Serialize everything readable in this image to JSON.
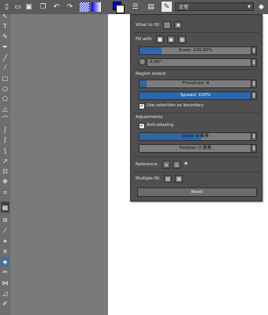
{
  "toolbar": {
    "blend_mode": "正常",
    "colors": {
      "primary": "#0000ff",
      "secondary": "#ffffff",
      "accent": "#2e66a8"
    }
  },
  "panel": {
    "what_to_fill": "What to fill",
    "fill_with": "Fill with",
    "scale_label": "Scale: 100.00%",
    "scale_fraction": 0.2,
    "angle_value": "0.00°",
    "region_extent": "Region extent",
    "threshold_label": "Threshold: 8",
    "threshold_fraction": 0.06,
    "spread_label": "Spread: 100%",
    "spread_fraction": 1.0,
    "use_selection_label": "Use selection as boundary",
    "use_selection_checked": true,
    "adjustments": "Adjustments",
    "antialiasing_label": "Anti-aliasing",
    "antialiasing_checked": true,
    "grow_label": "Grow: 0 像素",
    "grow_fraction": 0.55,
    "feather_label": "Feather: 0 像素",
    "feather_fraction": 0,
    "reference": "Reference",
    "multiple_fill": "Multiple fill",
    "reset": "Reset"
  }
}
